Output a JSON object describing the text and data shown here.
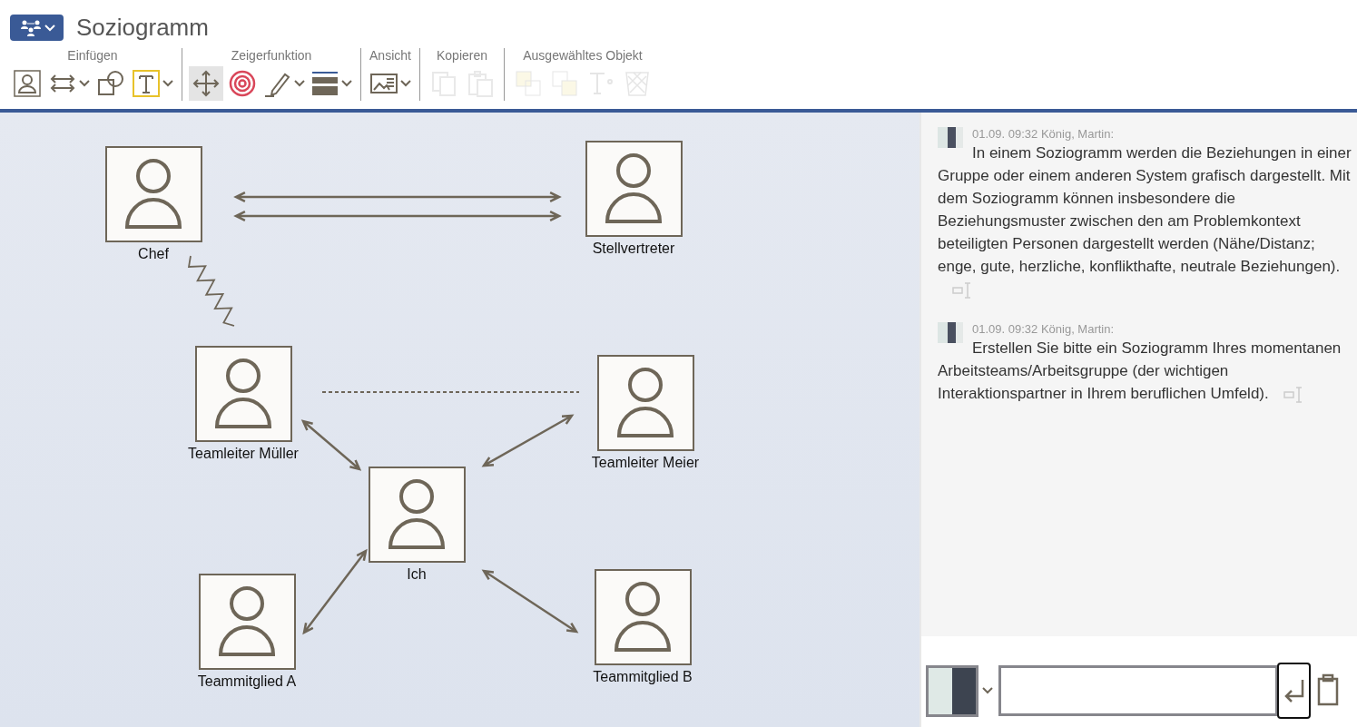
{
  "app": {
    "title": "Soziogramm"
  },
  "toolbar": {
    "groups": [
      {
        "label": "Einfügen",
        "tools": [
          {
            "selected": false,
            "disabled": false,
            "dropdown": false
          },
          {
            "selected": false,
            "disabled": false,
            "dropdown": true
          },
          {
            "selected": false,
            "disabled": false,
            "dropdown": false
          },
          {
            "selected": false,
            "disabled": false,
            "dropdown": true
          }
        ]
      },
      {
        "label": "Zeigerfunktion",
        "tools": [
          {
            "selected": true,
            "disabled": false,
            "dropdown": false
          },
          {
            "selected": false,
            "disabled": false,
            "dropdown": false
          },
          {
            "selected": false,
            "disabled": false,
            "dropdown": true
          },
          {
            "selected": false,
            "disabled": false,
            "dropdown": true
          }
        ]
      },
      {
        "label": "Ansicht",
        "tools": [
          {
            "selected": false,
            "disabled": false,
            "dropdown": true
          }
        ]
      },
      {
        "label": "Kopieren",
        "tools": [
          {
            "selected": false,
            "disabled": true,
            "dropdown": false
          },
          {
            "selected": false,
            "disabled": true,
            "dropdown": false
          }
        ]
      },
      {
        "label": "Ausgewähltes Objekt",
        "tools": [
          {
            "selected": false,
            "disabled": true,
            "dropdown": false
          },
          {
            "selected": false,
            "disabled": true,
            "dropdown": false
          },
          {
            "selected": false,
            "disabled": true,
            "dropdown": false
          },
          {
            "selected": false,
            "disabled": true,
            "dropdown": false
          }
        ]
      }
    ]
  },
  "sociogram": {
    "persons": [
      {
        "label": "Chef"
      },
      {
        "label": "Stellvertreter"
      },
      {
        "label": "Teamleiter Müller"
      },
      {
        "label": "Teamleiter Meier"
      },
      {
        "label": "Ich"
      },
      {
        "label": "Teammitglied A"
      },
      {
        "label": "Teammitglied B"
      }
    ],
    "relations": [
      {
        "kind": "strong"
      },
      {
        "kind": "conflict"
      },
      {
        "kind": "weak"
      },
      {
        "kind": "normal"
      },
      {
        "kind": "normal"
      },
      {
        "kind": "normal"
      },
      {
        "kind": "normal"
      }
    ]
  },
  "chat": {
    "messages": [
      {
        "meta": "01.09. 09:32 König, Martin:",
        "text": "In einem Soziogramm werden die Beziehungen in einer Gruppe oder einem anderen System grafisch dargestellt. Mit dem Soziogramm können insbesondere die Beziehungsmuster zwischen den am Problemkontext beteiligten Personen dargestellt werden (Nähe/Distanz; enge, gute, herzliche, konflikthafte, neutrale Beziehungen)."
      },
      {
        "meta": "01.09. 09:32 König, Martin:",
        "text": "Erstellen Sie bitte ein Soziogramm Ihres momentanen Arbeitsteams/Arbeitsgruppe (der wichtigen Interaktionspartner in Ihrem beruflichen Umfeld)."
      }
    ]
  }
}
